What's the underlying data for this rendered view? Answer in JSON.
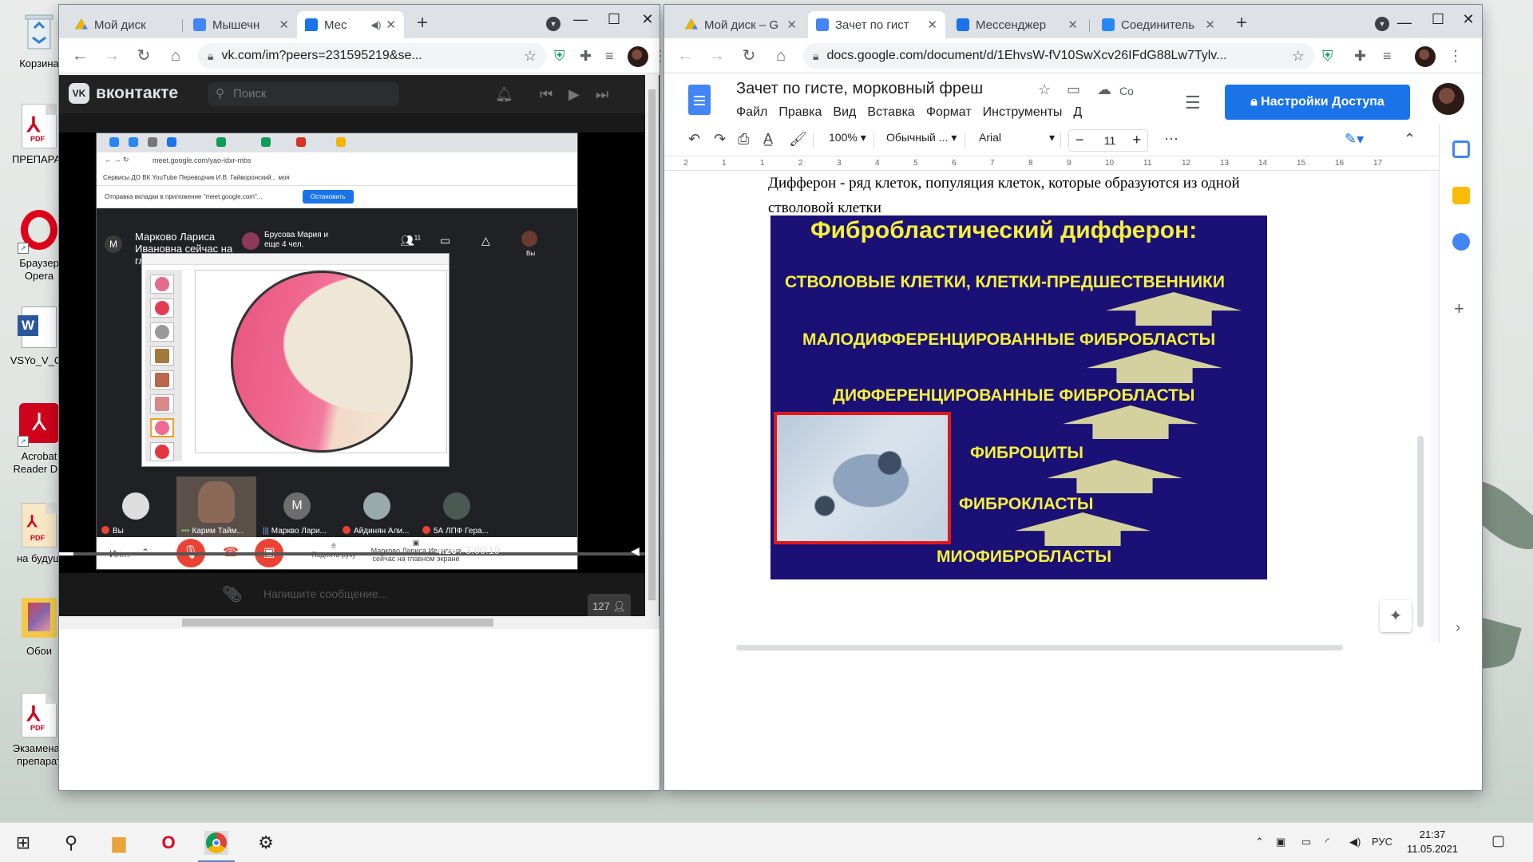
{
  "desktop": {
    "icons": [
      {
        "label": "Корзина",
        "icon": "recycle-bin-icon"
      },
      {
        "label": "ПРЕПАРАТ",
        "icon": "pdf-file-icon"
      },
      {
        "label": "Браузер Opera",
        "icon": "opera-icon"
      },
      {
        "label": "VSYo_V_OL",
        "icon": "word-file-icon"
      },
      {
        "label": "Acrobat Reader DC",
        "icon": "acrobat-icon"
      },
      {
        "label": "на будущ",
        "icon": "pdf-file-icon"
      },
      {
        "label": "Обои",
        "icon": "folder-icon"
      },
      {
        "label": "Экзаменац препарат",
        "icon": "pdf-file-icon"
      }
    ]
  },
  "vk_window": {
    "tabs": [
      {
        "title": "Мой диск",
        "icon": "google-drive-icon"
      },
      {
        "title": "Мышечн",
        "icon": "google-docs-icon"
      },
      {
        "title": "Мес",
        "icon": "messenger-icon",
        "active": true
      }
    ],
    "url": "vk.com/im?peers=231595219&se...",
    "vk": {
      "logo_text": "вконтакте",
      "search_placeholder": "Поиск",
      "composer_placeholder": "Напишите сообщение...",
      "viewers": "127"
    },
    "video": {
      "current_time": "4:26",
      "duration": "3:00:19",
      "progress": 0.0246
    },
    "meet": {
      "url": "meet.google.com/yao-idxr-mbs",
      "bookmarks": "Сервисы  ДО  ВК  YouTube  Переводчик  И.В. Гайворонский...  моя",
      "notice": "Отправка вкладки в приложение \"meet.google.com\"...",
      "notice_button": "Остановить",
      "presenter_initial": "М",
      "presenter_text": "Марково Лариса Ивановна сейчас на главном экране",
      "others_text": "Брусова Мария и еще 4 чел.",
      "participants_count": "11",
      "self_label": "Вы",
      "tiles": [
        {
          "name": "Вы",
          "muted": true
        },
        {
          "name": "Карим Тайм...",
          "muted": false
        },
        {
          "name": "Маркво Лари...",
          "muted": false,
          "initial": "М"
        },
        {
          "name": "Айдинян Али...",
          "muted": true
        },
        {
          "name": "5А ЛПФ Гера...",
          "muted": true
        }
      ],
      "controls": {
        "info": "Ин...",
        "raise_hand": "Поднять руку",
        "presenting": "Марково Лариса Ивановна сейчас на главном экране"
      }
    }
  },
  "docs_window": {
    "tabs": [
      {
        "title": "Мой диск – G",
        "icon": "google-drive-icon"
      },
      {
        "title": "Зачет по гист",
        "icon": "google-docs-icon",
        "active": true
      },
      {
        "title": "Мессенджер",
        "icon": "messenger-icon"
      },
      {
        "title": "Соединитель",
        "icon": "vk-icon"
      }
    ],
    "url": "docs.google.com/document/d/1EhvsW-fV10SwXcv26IFdG88Lw7Tylv...",
    "title": "Зачет по гисте, морковный фреш",
    "save_status": "Со",
    "menu": [
      "Файл",
      "Правка",
      "Вид",
      "Вставка",
      "Формат",
      "Инструменты",
      "Д"
    ],
    "share_label": "Настройки Доступа",
    "toolbar": {
      "zoom": "100%",
      "style": "Обычный ...",
      "font": "Arial",
      "font_size": "11"
    },
    "ruler": [
      "2",
      "1",
      "1",
      "2",
      "3",
      "4",
      "5",
      "6",
      "7",
      "8",
      "9",
      "10",
      "11",
      "12",
      "13",
      "14",
      "15",
      "16",
      "17"
    ],
    "body_text": "Дифферон - ряд клеток, популяция клеток, которые образуются из одной стволовой клетки",
    "slide": {
      "title": "Фибробластический дифферон:",
      "stages": [
        "СТВОЛОВЫЕ КЛЕТКИ, КЛЕТКИ-ПРЕДШЕСТВЕННИКИ",
        "МАЛОДИФФЕРЕНЦИРОВАННЫЕ  ФИБРОБЛАСТЫ",
        "ДИФФЕРЕНЦИРОВАННЫЕ ФИБРОБЛАСТЫ",
        "ФИБРОЦИТЫ",
        "ФИБРОКЛАСТЫ",
        "МИОФИБРОБЛАСТЫ"
      ]
    }
  },
  "taskbar": {
    "language": "РУС",
    "time": "21:37",
    "date": "11.05.2021"
  }
}
